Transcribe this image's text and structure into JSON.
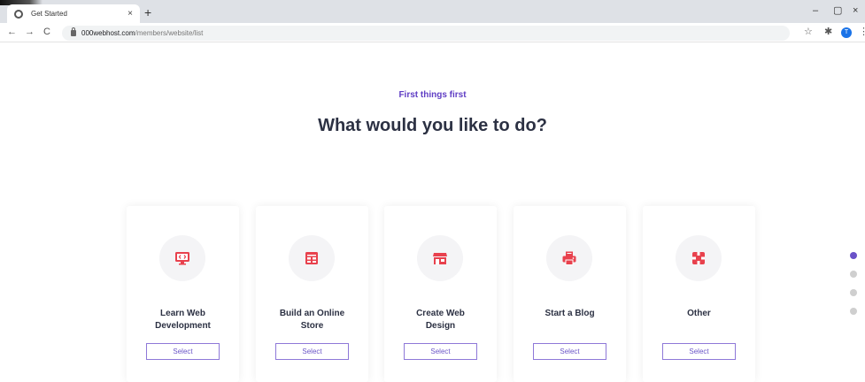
{
  "browser": {
    "tab_title": "Get Started",
    "tab_close": "×",
    "new_tab": "+",
    "url_host": "000webhost.com",
    "url_path": "/members/website/list",
    "back": "←",
    "forward": "→",
    "reload": "C",
    "star": "☆",
    "extensions": "✱",
    "profile_initial": "T",
    "menu": "⋮",
    "minimize": "–",
    "maximize": "▢",
    "close": "×"
  },
  "page": {
    "eyebrow": "First things first",
    "heading": "What would you like to do?"
  },
  "colors": {
    "accent": "#5f3dc4",
    "icon": "#e8414d"
  },
  "cards": [
    {
      "title_line1": "Learn Web",
      "title_line2": "Development",
      "icon": "monitor-code-icon",
      "button": "Select"
    },
    {
      "title_line1": "Build an Online",
      "title_line2": "Store",
      "icon": "store-grid-icon",
      "button": "Select"
    },
    {
      "title_line1": "Create Web",
      "title_line2": "Design",
      "icon": "storefront-icon",
      "button": "Select"
    },
    {
      "title_line1": "Start a Blog",
      "title_line2": "",
      "icon": "printer-blog-icon",
      "button": "Select"
    },
    {
      "title_line1": "Other",
      "title_line2": "",
      "icon": "puzzle-icon",
      "button": "Select"
    }
  ],
  "pagination": {
    "total": 4,
    "active_index": 0
  }
}
